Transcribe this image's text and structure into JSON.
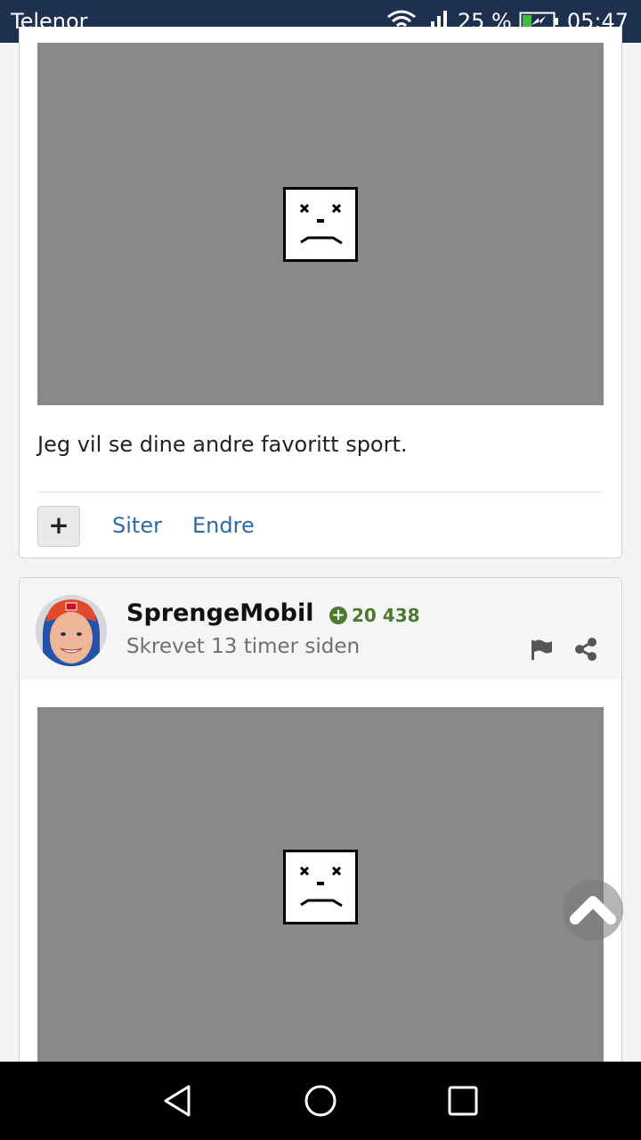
{
  "status_bar": {
    "carrier": "Telenor",
    "battery_percent": "25 %",
    "time": "05:47"
  },
  "post1": {
    "text": "Jeg vil se dine andre favoritt sport.",
    "quote_label": "Siter",
    "edit_label": "Endre",
    "plus_label": "+"
  },
  "post2": {
    "author": "SprengeMobil",
    "reputation": "20 438",
    "timestamp": "Skrevet 13 timer siden"
  },
  "colors": {
    "status_bar": "#1e3050",
    "link": "#2d6aa6",
    "reputation": "#4c7a31",
    "image_placeholder": "#898989"
  },
  "icons": {
    "wifi": "wifi-icon",
    "signal": "signal-icon",
    "battery": "battery-charging-icon",
    "broken_image": "broken-image-sad-face-icon",
    "report": "flag-icon",
    "share": "share-icon",
    "scroll_top": "chevron-up-icon",
    "nav_back": "triangle-back-icon",
    "nav_home": "circle-home-icon",
    "nav_recent": "square-recent-icon"
  }
}
